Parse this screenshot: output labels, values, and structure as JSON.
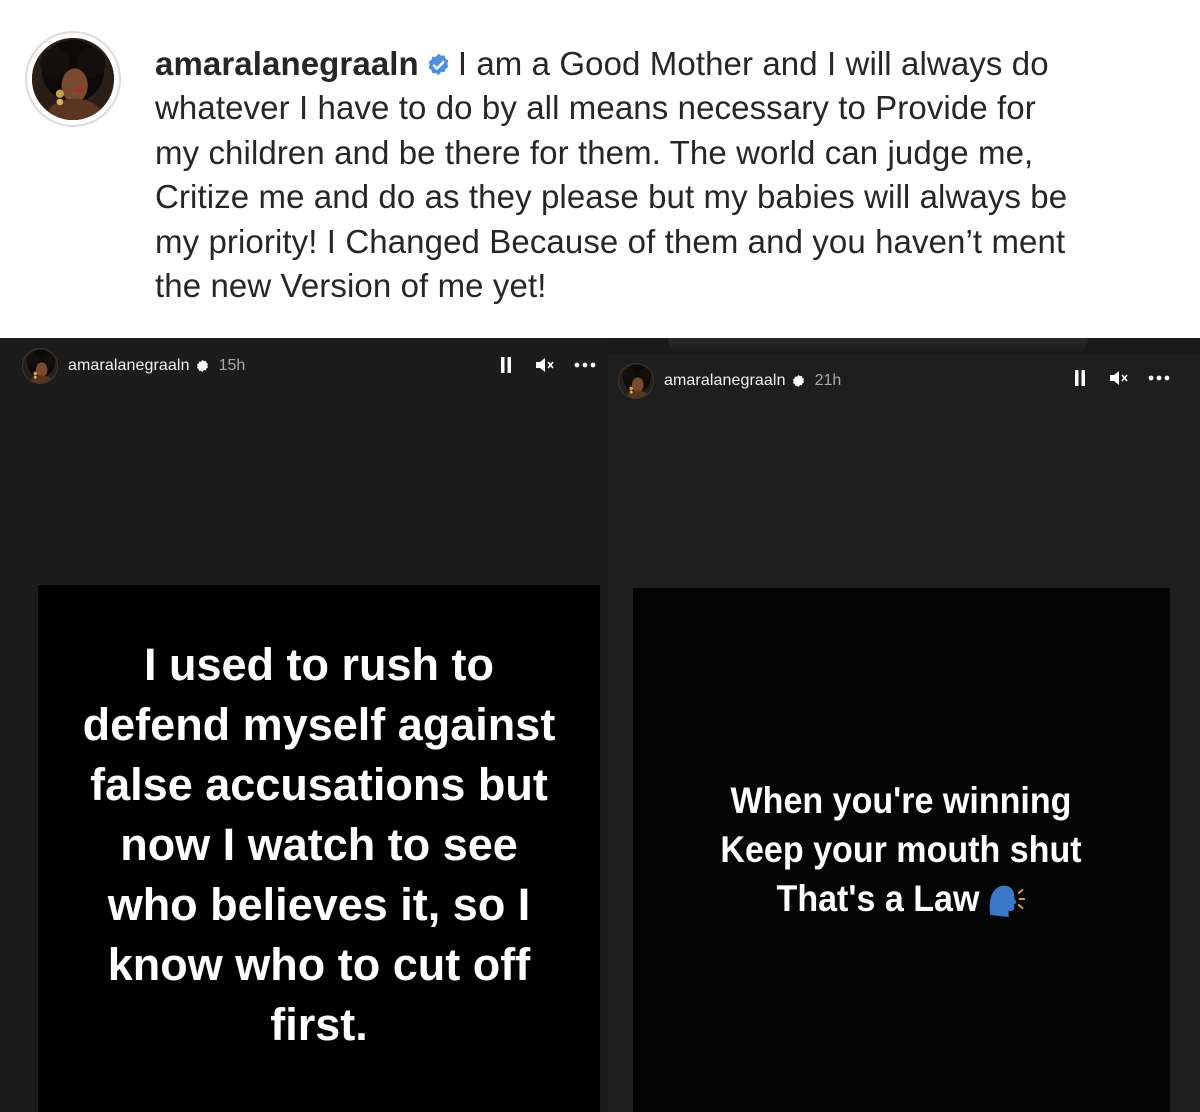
{
  "post": {
    "username": "amaralanegraaln",
    "caption_lines": [
      "I am a Good Mother and I will always do",
      "whatever I have to do by all means necessary to Provide for",
      "my children and be there for them. The world can judge me,",
      "Critize me and do as they please but my babies will always be",
      "my priority! I Changed Because of them and you haven’t ment",
      "the new Version of me yet!"
    ]
  },
  "stories": [
    {
      "username": "amaralanegraaln",
      "time": "15h",
      "text_lines": [
        "I used to rush to",
        "defend myself against",
        "false accusations but",
        "now I watch to see",
        "who believes it, so I",
        "know who to cut off",
        "first."
      ]
    },
    {
      "username": "amaralanegraaln",
      "time": "21h",
      "text_lines": [
        "When you're winning",
        "Keep your mouth shut",
        "That's a Law"
      ],
      "emoji_icon": "speaking-head-icon"
    }
  ],
  "icons": {
    "verified": "verified-badge-icon",
    "pause": "pause-icon",
    "mute": "muted-speaker-icon",
    "more": "more-options-icon"
  },
  "colors": {
    "verified_blue": "#4a90e2",
    "caption_text": "#262626",
    "story_bg": "#1c1c1c",
    "card_bg": "#000000"
  }
}
